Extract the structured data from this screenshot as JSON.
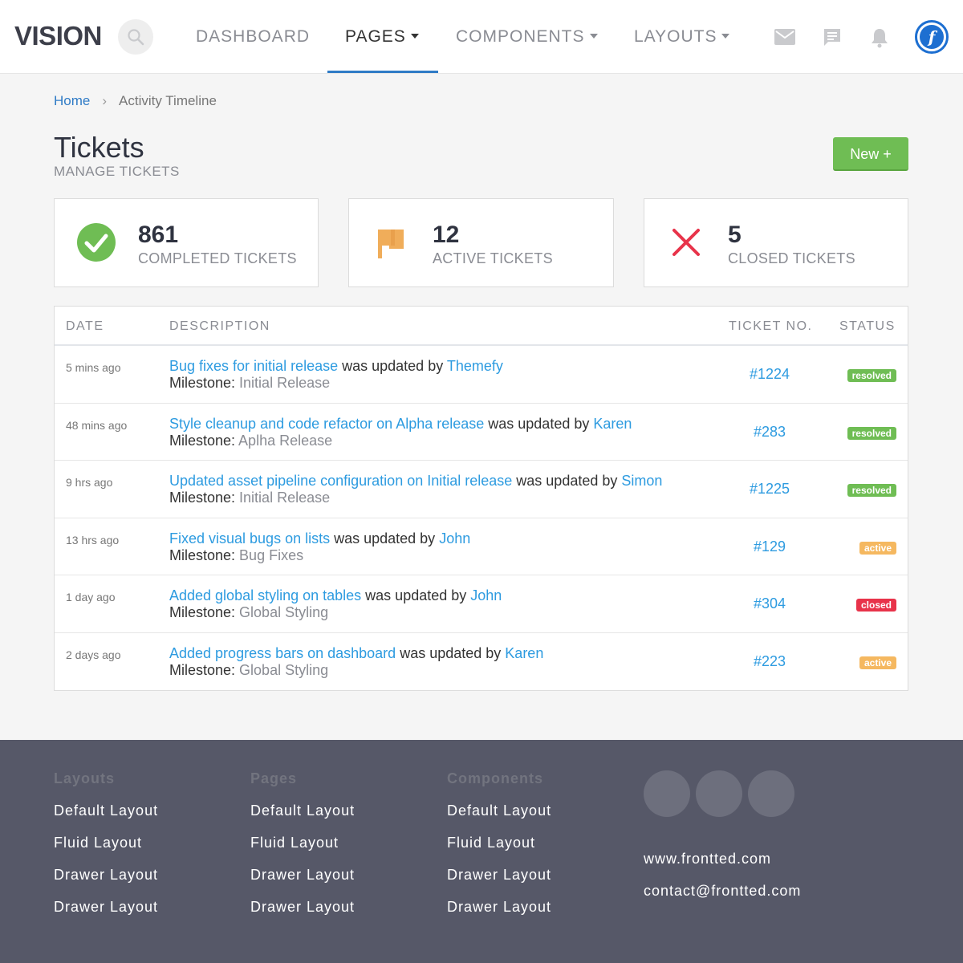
{
  "header": {
    "brand": "VISION",
    "nav": [
      {
        "label": "DASHBOARD",
        "has_caret": false,
        "active": false
      },
      {
        "label": "PAGES",
        "has_caret": true,
        "active": true
      },
      {
        "label": "COMPONENTS",
        "has_caret": true,
        "active": false
      },
      {
        "label": "LAYOUTS",
        "has_caret": true,
        "active": false
      }
    ],
    "icons": [
      "mail-icon",
      "chat-icon",
      "bell-icon"
    ],
    "avatar_letter": "f"
  },
  "breadcrumb": {
    "home": "Home",
    "separator": "›",
    "current": "Activity Timeline"
  },
  "page": {
    "title": "Tickets",
    "subtitle": "MANAGE TICKETS",
    "new_button": "New +"
  },
  "stats": [
    {
      "value": "861",
      "label": "COMPLETED TICKETS",
      "icon": "check-circle-icon",
      "color": "#6fbd54"
    },
    {
      "value": "12",
      "label": "ACTIVE TICKETS",
      "icon": "flag-icon",
      "color": "#f0ad5a"
    },
    {
      "value": "5",
      "label": "CLOSED TICKETS",
      "icon": "x-icon",
      "color": "#e8334a"
    }
  ],
  "table": {
    "headers": {
      "date": "DATE",
      "description": "DESCRIPTION",
      "ticket": "TICKET NO.",
      "status": "STATUS"
    },
    "rows": [
      {
        "date": "5 mins ago",
        "title": "Bug fixes for initial release",
        "updated_by_text": " was updated by ",
        "user": "Themefy",
        "milestone_label": "Milestone: ",
        "milestone": "Initial Release",
        "ticket": "#1224",
        "status": "resolved"
      },
      {
        "date": "48 mins ago",
        "title": "Style cleanup and code refactor on Alpha release",
        "updated_by_text": " was updated by ",
        "user": "Karen",
        "milestone_label": "Milestone: ",
        "milestone": "Aplha Release",
        "ticket": "#283",
        "status": "resolved"
      },
      {
        "date": "9 hrs ago",
        "title": "Updated asset pipeline configuration on Initial release",
        "updated_by_text": " was updated by ",
        "user": "Simon",
        "milestone_label": "Milestone: ",
        "milestone": "Initial Release",
        "ticket": "#1225",
        "status": "resolved"
      },
      {
        "date": "13 hrs ago",
        "title": "Fixed visual bugs on lists",
        "updated_by_text": " was updated by ",
        "user": "John",
        "milestone_label": "Milestone: ",
        "milestone": "Bug Fixes",
        "ticket": "#129",
        "status": "active"
      },
      {
        "date": "1 day ago",
        "title": "Added global styling on tables",
        "updated_by_text": " was updated by ",
        "user": "John",
        "milestone_label": "Milestone: ",
        "milestone": "Global Styling",
        "ticket": "#304",
        "status": "closed"
      },
      {
        "date": "2 days ago",
        "title": "Added progress bars on dashboard",
        "updated_by_text": " was updated by ",
        "user": "Karen",
        "milestone_label": "Milestone: ",
        "milestone": "Global Styling",
        "ticket": "#223",
        "status": "active"
      }
    ]
  },
  "status_colors": {
    "resolved": "#6fbd54",
    "active": "#f5b860",
    "closed": "#e8334a"
  },
  "footer": {
    "columns": [
      {
        "heading": "Layouts",
        "links": [
          "Default Layout",
          "Fluid Layout",
          "Drawer Layout",
          "Drawer Layout"
        ]
      },
      {
        "heading": "Pages",
        "links": [
          "Default Layout",
          "Fluid Layout",
          "Drawer Layout",
          "Drawer Layout"
        ]
      },
      {
        "heading": "Components",
        "links": [
          "Default Layout",
          "Fluid Layout",
          "Drawer Layout",
          "Drawer Layout"
        ]
      }
    ],
    "website": "www.frontted.com",
    "email": "contact@frontted.com"
  }
}
